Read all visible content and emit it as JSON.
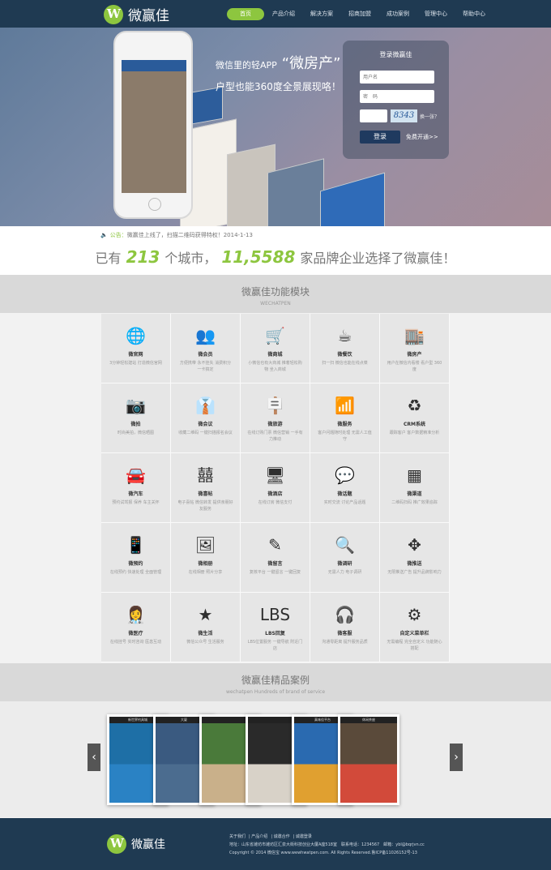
{
  "brand": {
    "name": "微赢佳"
  },
  "nav": [
    "首页",
    "产品介绍",
    "解决方案",
    "招商加盟",
    "成功案例",
    "管理中心",
    "帮助中心"
  ],
  "banner": {
    "slogan_line1": "微信里的轻APP",
    "slogan_big": "“微房产”",
    "slogan_line2": "户型也能360度全景展现咯！"
  },
  "login": {
    "title": "登录微赢佳",
    "username_placeholder": "用户名",
    "password_placeholder": "密　码",
    "captcha": "8343",
    "change": "换一张？",
    "submit": "登录",
    "signup": "免费开通>>"
  },
  "notice": {
    "label": "公告：",
    "text": "微赢佳上线了，扫描二维码获得特权！2014-1-13"
  },
  "stats": {
    "prefix": "已有",
    "cities": "213",
    "mid": "个城市，",
    "brands": "11,5588",
    "suffix": "家品牌企业选择了微赢佳！"
  },
  "features_section": {
    "title": "微赢佳功能模块",
    "subtitle": "WECHATPEN"
  },
  "features": [
    {
      "icon": "globe-icon",
      "glyph": "🌐",
      "name": "微官网",
      "desc": "3分钟轻松建站 打造微信官网"
    },
    {
      "icon": "members-icon",
      "glyph": "👥",
      "name": "微会员",
      "desc": "方便携带 永不挂失 消费积分 一卡搞定"
    },
    {
      "icon": "cart-icon",
      "glyph": "🛒",
      "name": "微商城",
      "desc": "小微信也有大商城 推着轻松购物 坐入商城"
    },
    {
      "icon": "coffee-icon",
      "glyph": "☕",
      "name": "微餐饮",
      "desc": "扫一扫 微信也能在线点菜"
    },
    {
      "icon": "shop-icon",
      "glyph": "🏬",
      "name": "微房产",
      "desc": "用户在微信内看楼 看户型 360度"
    },
    {
      "icon": "camera-icon",
      "glyph": "📷",
      "name": "微拍",
      "desc": "时尚美拍，微信晒图"
    },
    {
      "icon": "tie-icon",
      "glyph": "👔",
      "name": "微会议",
      "desc": "收藏二维码 一键扫描报名会议"
    },
    {
      "icon": "signpost-icon",
      "glyph": "🪧",
      "name": "微旅游",
      "desc": "在线订购门票 微信营销 一手有力推动"
    },
    {
      "icon": "wifi-icon",
      "glyph": "📶",
      "name": "微服务",
      "desc": "客户问题随时处理 无需人工值守"
    },
    {
      "icon": "recycle-icon",
      "glyph": "♻",
      "name": "CRM系统",
      "desc": "跟踪客户 客户数据精准分析"
    },
    {
      "icon": "car-icon",
      "glyph": "🚘",
      "name": "微汽车",
      "desc": "预约试驾报 保养 车主关怀"
    },
    {
      "icon": "wedding-icon",
      "glyph": "囍",
      "name": "微喜帖",
      "desc": "电子喜帖 微信转发 提供亲朋好友服务"
    },
    {
      "icon": "monitor-icon",
      "glyph": "🖥",
      "name": "微酒店",
      "desc": "在线订房 微信支付"
    },
    {
      "icon": "chat-icon",
      "glyph": "💬",
      "name": "微话题",
      "desc": "实时交流 讨论产品话题"
    },
    {
      "icon": "qrcode-icon",
      "glyph": "▦",
      "name": "微渠道",
      "desc": "二维码扫码 推广效果追踪"
    },
    {
      "icon": "sms-icon",
      "glyph": "📱",
      "name": "微预约",
      "desc": "在线预约 快速处理 全面管理"
    },
    {
      "icon": "picture-icon",
      "glyph": "🖼",
      "name": "微相册",
      "desc": "在线相册 照片分享"
    },
    {
      "icon": "pen-icon",
      "glyph": "✎",
      "name": "微留言",
      "desc": "复核平台 一键留言 一键回复"
    },
    {
      "icon": "search-icon",
      "glyph": "🔍",
      "name": "微调研",
      "desc": "无需人力 电子调研"
    },
    {
      "icon": "move-icon",
      "glyph": "✥",
      "name": "微推送",
      "desc": "无限推送广告 提升品牌影响力"
    },
    {
      "icon": "nurse-icon",
      "glyph": "👩‍⚕",
      "name": "微医疗",
      "desc": "在线挂号 实时咨询 医患互动"
    },
    {
      "icon": "star-icon",
      "glyph": "★",
      "name": "微生活",
      "desc": "微信公众号 生活服务"
    },
    {
      "icon": "lbs-icon",
      "glyph": "LBS",
      "name": "LBS回复",
      "desc": "LBS位置服务 一键导航 附近门店"
    },
    {
      "icon": "headset-icon",
      "glyph": "🎧",
      "name": "微客服",
      "desc": "沟通零距离 提升服务品质"
    },
    {
      "icon": "gear-icon",
      "glyph": "⚙",
      "name": "自定义菜单栏",
      "desc": "无需编程 完全自定义 功能随心搭配"
    }
  ],
  "cases_section": {
    "title": "微赢佳精品案例",
    "subtitle": "wechatpen Hundreds of brand of service"
  },
  "cases": [
    {
      "title": "新世界钓具城",
      "top": "#1e6fa6",
      "bottom": "#2a82c4"
    },
    {
      "title": "大厦",
      "top": "#3a5a80",
      "bottom": "#4b6c8f"
    },
    {
      "title": "",
      "top": "#4a7a3a",
      "bottom": "#c9b08a"
    },
    {
      "title": "",
      "top": "#2a2a2a",
      "bottom": "#d8d2c8"
    },
    {
      "title": "真味佳平台",
      "top": "#2a6ab0",
      "bottom": "#e0a030"
    },
    {
      "title": "休闲茶座",
      "top": "#5a4a3a",
      "bottom": "#d24a3a"
    }
  ],
  "footer": {
    "links": [
      "关于我们",
      "产品介绍",
      "诚邀合作",
      "诚邀登录"
    ],
    "address": "地址：山东省潍坊市潍坊区汇泉大街科技创业大厦A座518室　联系电话：1234567　邮箱：ybl@bqrjvn.cc",
    "copyright": "Copyright © 2014 微信宝 www.wewhwatpen.com. All Rights Reserved.鲁ICP备11026152号-13"
  },
  "colors": {
    "accent": "#8dc63f",
    "dark": "#1f3a52"
  }
}
